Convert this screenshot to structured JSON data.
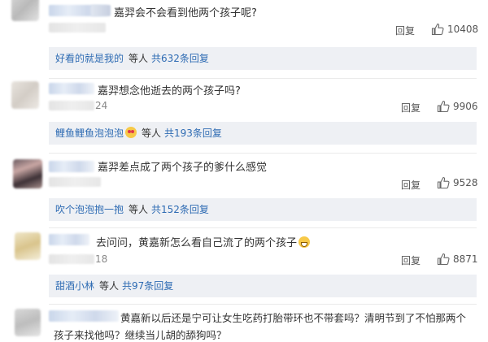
{
  "comments": [
    {
      "text": "嘉羿会不会看到他两个孩子呢?",
      "time_fragment": "",
      "reply_label": "回复",
      "likes": "10408",
      "thread": {
        "user": "好看的就是我的",
        "mid": "等人",
        "more": "共632条回复"
      }
    },
    {
      "text": "嘉羿想念他逝去的两个孩子吗?",
      "time_fragment": "24",
      "reply_label": "回复",
      "likes": "9906",
      "thread": {
        "user": "鲤鱼鲤鱼泡泡泡",
        "mid": "等人",
        "more": "共193条回复"
      }
    },
    {
      "text": "嘉羿差点成了两个孩子的爹什么感觉",
      "time_fragment": "",
      "reply_label": "回复",
      "likes": "9528",
      "thread": {
        "user": "吹个泡泡抱一抱",
        "mid": "等人",
        "more": "共152条回复"
      }
    },
    {
      "text": "去问问，黄嘉新怎么看自己流了的两个孩子",
      "time_fragment": "18",
      "reply_label": "回复",
      "likes": "8871",
      "thread": {
        "user": "甜酒小林",
        "mid": "等人",
        "more": "共97条回复"
      }
    },
    {
      "text_line1": "黄嘉新以后还是宁可让女生吃药打胎带环也不带套吗？清明节到了不怕那两个",
      "text_line2": "孩子来找他吗？继续当儿胡的舔狗吗？"
    }
  ]
}
